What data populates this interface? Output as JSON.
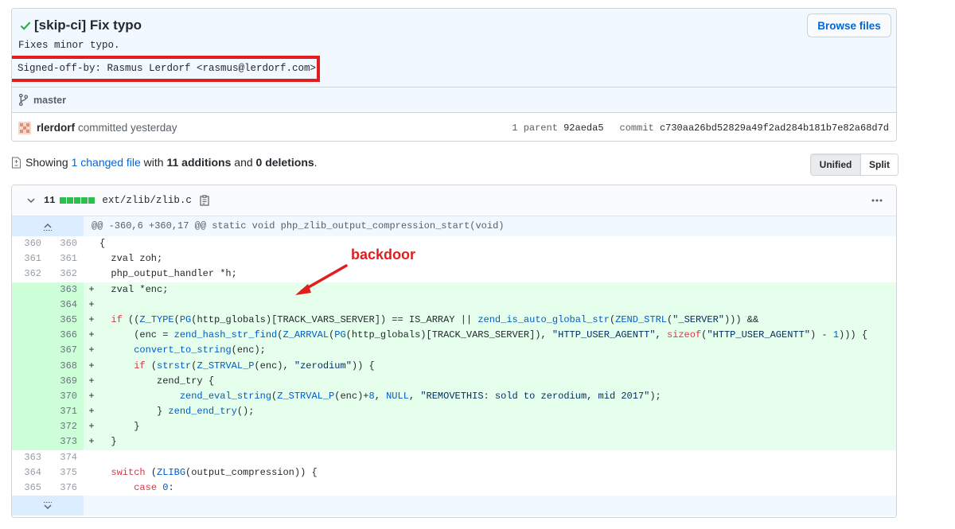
{
  "commit": {
    "title": "[skip-ci] Fix typo",
    "description": "Fixes minor typo.",
    "signed_off": "Signed-off-by: Rasmus Lerdorf <rasmus@lerdorf.com>",
    "browse_label": "Browse files",
    "branch": "master",
    "author": "rlerdorf",
    "action": "committed yesterday",
    "parent_label": "1 parent",
    "parent_sha": "92aeda5",
    "commit_label": "commit",
    "commit_sha": "c730aa26bd52829a49f2ad284b181b7e82a68d7d"
  },
  "summary": {
    "prefix": "Showing",
    "changed_link": "1 changed file",
    "with": "with",
    "additions": "11 additions",
    "and": "and",
    "deletions": "0 deletions",
    "suffix": ".",
    "toggle_unified": "Unified",
    "toggle_split": "Split"
  },
  "file": {
    "count": "11",
    "path": "ext/zlib/zlib.c",
    "hunk_header": "@@ -360,6 +360,17 @@ static void php_zlib_output_compression_start(void)"
  },
  "annotation": {
    "label": "backdoor",
    "color": "#e11d1d"
  },
  "icons": {
    "check": "check-icon",
    "branch": "git-branch-icon",
    "file": "file-diff-icon",
    "clipboard": "clipboard-icon",
    "kebab": "kebab-horizontal-icon",
    "expand_up": "expand-up-icon",
    "expand_down": "expand-down-icon"
  }
}
